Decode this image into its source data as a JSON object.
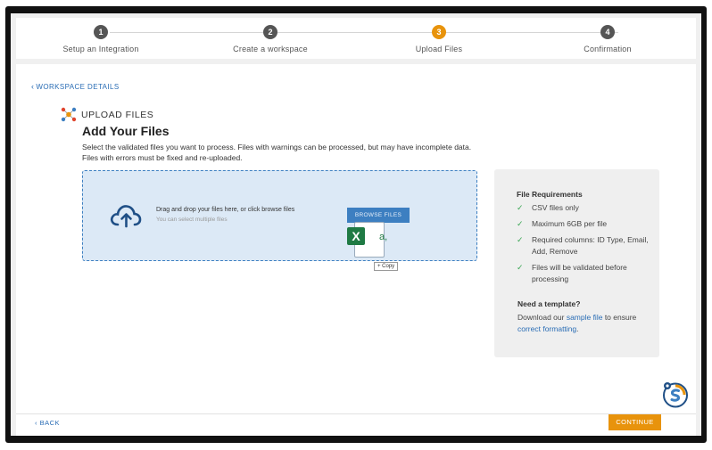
{
  "stepper": {
    "steps": [
      {
        "number": "1",
        "label": "Setup an Integration"
      },
      {
        "number": "2",
        "label": "Create a workspace"
      },
      {
        "number": "3",
        "label": "Upload Files"
      },
      {
        "number": "4",
        "label": "Confirmation"
      }
    ],
    "active_index": 2
  },
  "nav": {
    "back_link": "WORKSPACE DETAILS"
  },
  "section": {
    "label": "UPLOAD FILES",
    "title": "Add Your Files",
    "description": "Select the validated files you want to process. Files with warnings can be processed, but may have incomplete data. Files with errors must be fixed and re-uploaded."
  },
  "dropzone": {
    "main_text": "Drag and drop your files here, or click browse files",
    "sub_text": "You can select multiple files",
    "browse_label": "BROWSE FILES",
    "dragged_file_icon": "excel-icon",
    "dragged_file_letter": "X",
    "dragged_file_glyph": "a,",
    "copy_tooltip": "+ Copy"
  },
  "requirements": {
    "title": "File Requirements",
    "items": [
      "CSV files only",
      "Maximum 6GB per file",
      "Required columns: ID Type, Email, Add, Remove",
      "Files will be validated before processing"
    ],
    "template_title": "Need a template?",
    "template_prefix": "Download our ",
    "template_link1": "sample file",
    "template_mid": " to ensure ",
    "template_link2": "correct formatting",
    "template_suffix": "."
  },
  "footer": {
    "back_label": "BACK",
    "continue_label": "CONTINUE"
  },
  "colors": {
    "accent": "#e8930c",
    "link": "#2a6db5",
    "dropzone_bg": "#dce9f6",
    "check": "#3aa654"
  }
}
